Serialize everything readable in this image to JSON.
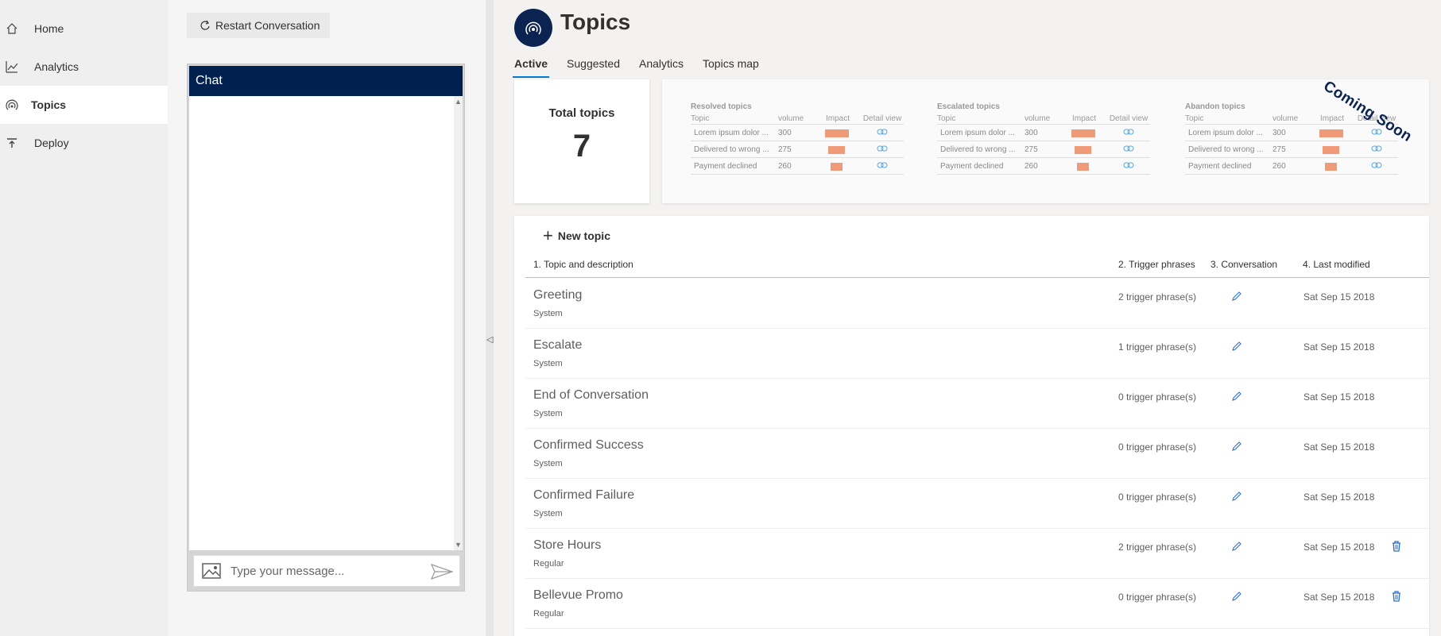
{
  "nav": {
    "items": [
      {
        "label": "Home",
        "icon": "home-icon"
      },
      {
        "label": "Analytics",
        "icon": "analytics-icon"
      },
      {
        "label": "Topics",
        "icon": "topics-icon",
        "active": true
      },
      {
        "label": "Deploy",
        "icon": "deploy-icon"
      }
    ]
  },
  "chat": {
    "restart_label": "Restart Conversation",
    "header": "Chat",
    "input_placeholder": "Type your message..."
  },
  "main": {
    "title": "Topics",
    "tabs": [
      {
        "label": "Active",
        "active": true
      },
      {
        "label": "Suggested"
      },
      {
        "label": "Analytics"
      },
      {
        "label": "Topics map"
      }
    ],
    "total": {
      "label": "Total topics",
      "value": "7"
    },
    "stats": {
      "coming_soon": "Coming Soon",
      "columns": [
        "Topic",
        "volume",
        "Impact",
        "Detail view"
      ],
      "blocks": [
        {
          "title": "Resolved topics",
          "rows": [
            {
              "topic": "Lorem ipsum dolor ...",
              "volume": "300",
              "impact": 1.0
            },
            {
              "topic": "Delivered to wrong ...",
              "volume": "275",
              "impact": 0.7
            },
            {
              "topic": "Payment declined",
              "volume": "260",
              "impact": 0.5
            }
          ]
        },
        {
          "title": "Escalated topics",
          "rows": [
            {
              "topic": "Lorem ipsum dolor ...",
              "volume": "300",
              "impact": 1.0
            },
            {
              "topic": "Delivered to wrong ...",
              "volume": "275",
              "impact": 0.7
            },
            {
              "topic": "Payment declined",
              "volume": "260",
              "impact": 0.5
            }
          ]
        },
        {
          "title": "Abandon topics",
          "rows": [
            {
              "topic": "Lorem ipsum dolor ...",
              "volume": "300",
              "impact": 1.0
            },
            {
              "topic": "Delivered to wrong ...",
              "volume": "275",
              "impact": 0.7
            },
            {
              "topic": "Payment declined",
              "volume": "260",
              "impact": 0.5
            }
          ]
        }
      ]
    },
    "list": {
      "new_topic_label": "New topic",
      "columns": {
        "topic": "1. Topic and description",
        "trigger": "2. Trigger phrases",
        "conversation": "3. Conversation",
        "modified": "4. Last modified"
      },
      "rows": [
        {
          "name": "Greeting",
          "type": "System",
          "trigger": "2 trigger phrase(s)",
          "modified": "Sat Sep 15 2018",
          "deletable": false
        },
        {
          "name": "Escalate",
          "type": "System",
          "trigger": "1 trigger phrase(s)",
          "modified": "Sat Sep 15 2018",
          "deletable": false
        },
        {
          "name": "End of Conversation",
          "type": "System",
          "trigger": "0 trigger phrase(s)",
          "modified": "Sat Sep 15 2018",
          "deletable": false
        },
        {
          "name": "Confirmed Success",
          "type": "System",
          "trigger": "0 trigger phrase(s)",
          "modified": "Sat Sep 15 2018",
          "deletable": false
        },
        {
          "name": "Confirmed Failure",
          "type": "System",
          "trigger": "0 trigger phrase(s)",
          "modified": "Sat Sep 15 2018",
          "deletable": false
        },
        {
          "name": "Store Hours",
          "type": "Regular",
          "trigger": "2 trigger phrase(s)",
          "modified": "Sat Sep 15 2018",
          "deletable": true
        },
        {
          "name": "Bellevue Promo",
          "type": "Regular",
          "trigger": "0 trigger phrase(s)",
          "modified": "Sat Sep 15 2018",
          "deletable": true
        }
      ]
    }
  },
  "colors": {
    "brand_dark": "#002050",
    "accent": "#0078d4",
    "impact_bar": "#ef9b7a",
    "delete_icon": "#2f6fc4"
  }
}
